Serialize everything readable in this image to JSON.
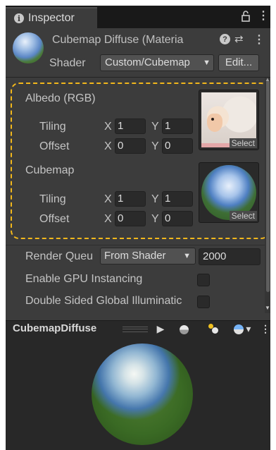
{
  "tab": {
    "title": "Inspector"
  },
  "header": {
    "material_title": "Cubemap Diffuse (Materia",
    "shader_label": "Shader",
    "shader_value": "Custom/Cubemap",
    "edit_label": "Edit..."
  },
  "albedo": {
    "label": "Albedo (RGB)",
    "tiling_label": "Tiling",
    "offset_label": "Offset",
    "tiling_x": "1",
    "tiling_y": "1",
    "offset_x": "0",
    "offset_y": "0",
    "select_label": "Select"
  },
  "cubemap": {
    "label": "Cubemap",
    "tiling_label": "Tiling",
    "offset_label": "Offset",
    "tiling_x": "1",
    "tiling_y": "1",
    "offset_x": "0",
    "offset_y": "0",
    "select_label": "Select"
  },
  "axes": {
    "x": "X",
    "y": "Y"
  },
  "render_queue": {
    "label": "Render Queu",
    "dropdown": "From Shader",
    "value": "2000"
  },
  "gpu_instancing": {
    "label": "Enable GPU Instancing",
    "checked": false
  },
  "double_sided_gi": {
    "label": "Double Sided Global Illuminatic",
    "checked": false
  },
  "preview": {
    "title": "CubemapDiffuse"
  },
  "colors": {
    "highlight": "#f2b71c",
    "background": "#3c3c3c"
  },
  "icons": [
    "info-icon",
    "lock-icon",
    "kebab-menu-icon",
    "help-icon",
    "preset-icon",
    "dropdown-caret-icon",
    "play-icon",
    "sphere-icon",
    "light-icon",
    "skybox-sphere-icon"
  ]
}
